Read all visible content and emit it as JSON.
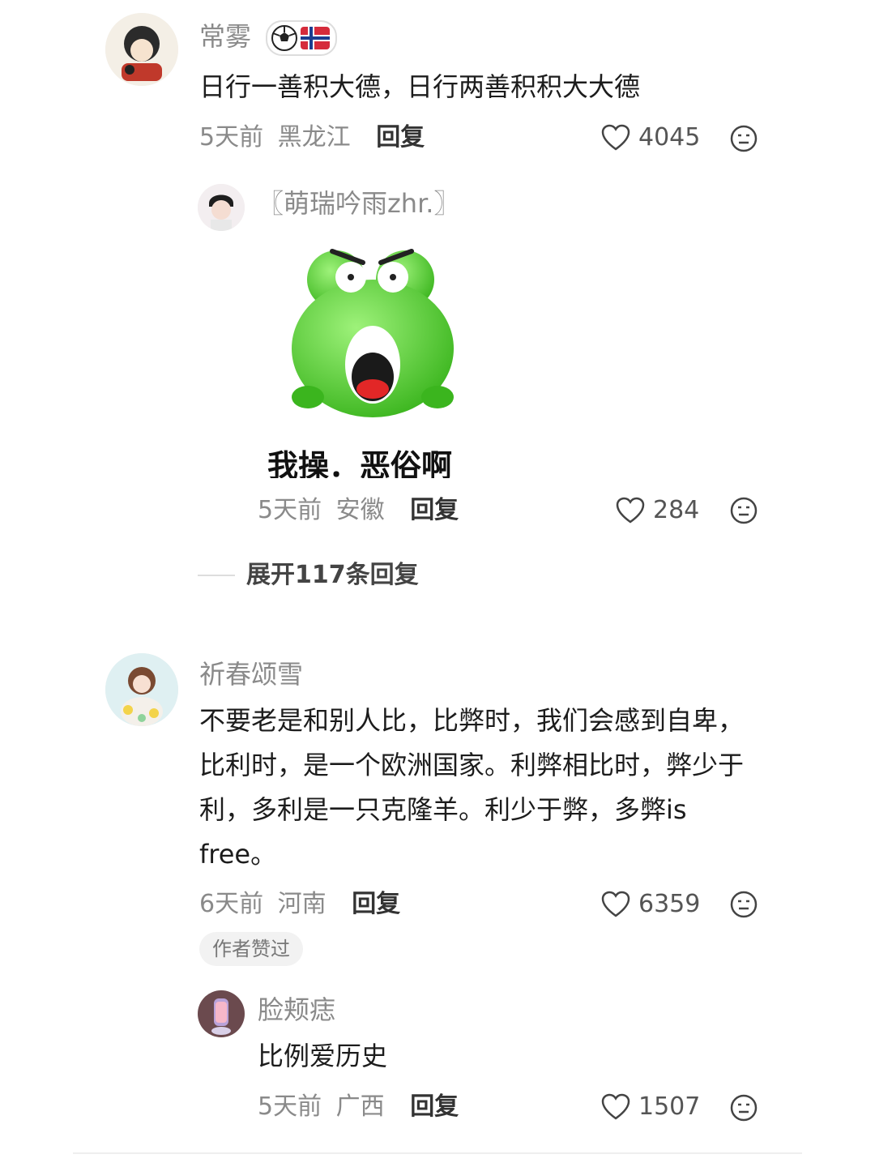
{
  "comments": [
    {
      "user": "常雾",
      "badges": [
        "soccer-ball-icon",
        "norway-flag-icon"
      ],
      "text": "日行一善积大德，日行两善积积大大德",
      "time": "5天前",
      "location": "黑龙江",
      "reply_label": "回复",
      "likes": "4045",
      "reply": {
        "user": "〖萌瑞吟雨zhr.〗",
        "sticker_caption": "我操．恶俗啊",
        "time": "5天前",
        "location": "安徽",
        "reply_label": "回复",
        "likes": "284"
      },
      "expand_label": "展开117条回复"
    },
    {
      "user": "祈春颂雪",
      "text": "不要老是和别人比，比弊时，我们会感到自卑，比利时，是一个欧洲国家。利弊相比时，弊少于利，多利是一只克隆羊。利少于弊，多弊is free。",
      "time": "6天前",
      "location": "河南",
      "reply_label": "回复",
      "likes": "6359",
      "author_liked": "作者赞过",
      "reply": {
        "user": "脸颊痣",
        "text": "比例爱历史",
        "time": "5天前",
        "location": "广西",
        "reply_label": "回复",
        "likes": "1507"
      }
    }
  ],
  "colors": {
    "meta": "#8a8a8a",
    "sticker_green": "#5fd43a",
    "badge_border": "#dddddd"
  }
}
